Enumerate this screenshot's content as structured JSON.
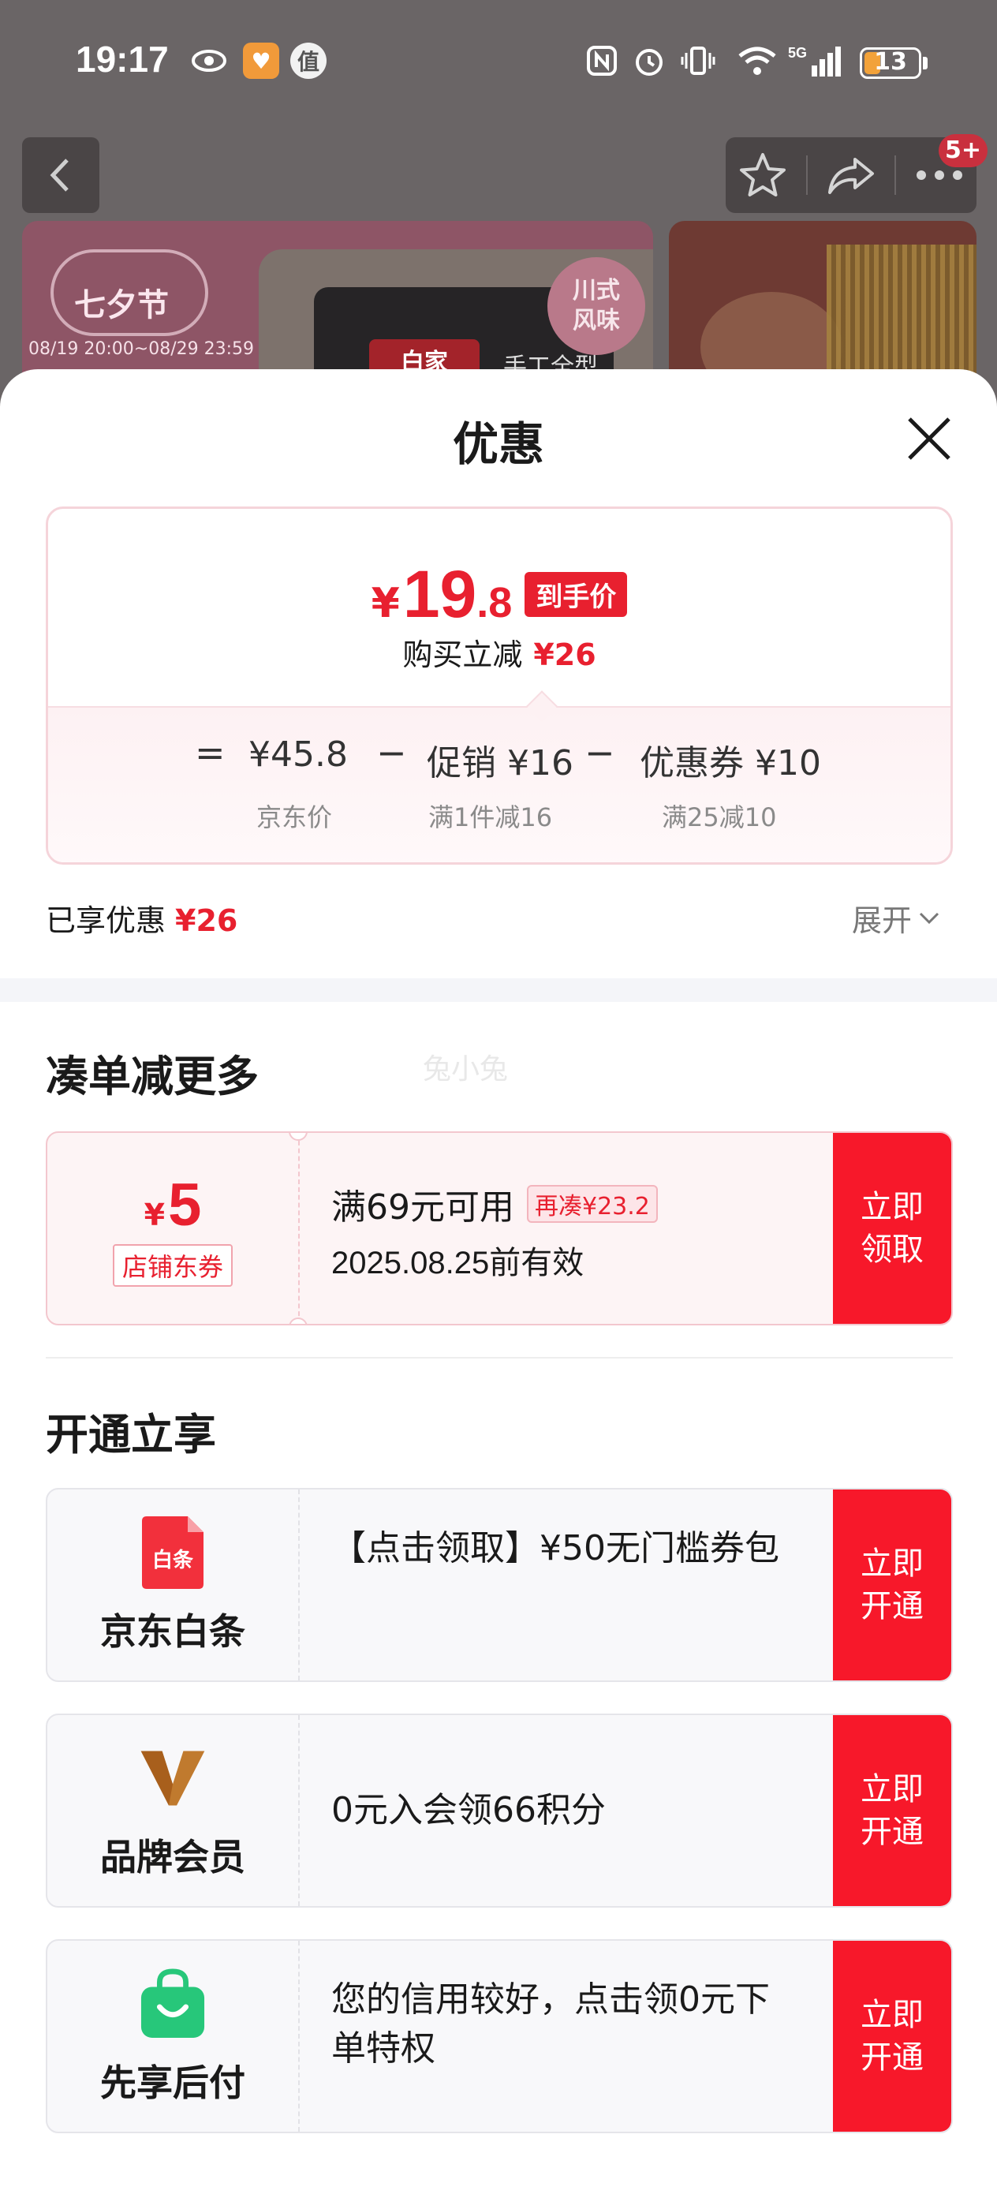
{
  "status_bar": {
    "time": "19:17",
    "value_badge": "值",
    "battery": "13"
  },
  "nav": {
    "message_badge": "5+"
  },
  "banner": {
    "festival": "七夕节",
    "festival_dates": "08/19 20:00~08/29 23:59",
    "flavor": "川式风味",
    "brand_label": "白家",
    "product_text": "手工全型"
  },
  "sheet": {
    "title": "优惠",
    "price_card": {
      "yen": "¥",
      "price_int": "19",
      "price_dec": ".8",
      "price_tag": "到手价",
      "discount_label": "购买立减",
      "discount_value": "¥26",
      "formula": {
        "equals": "=",
        "jd_price": "¥45.8",
        "jd_price_label": "京东价",
        "minus1": "−",
        "promo": "促销 ¥16",
        "promo_label": "满1件减16",
        "minus2": "−",
        "coupon": "优惠券 ¥10",
        "coupon_label": "满25减10"
      }
    },
    "enjoyed_label": "已享优惠",
    "enjoyed_value": "¥26",
    "expand_label": "展开",
    "watermark": "兔小兔",
    "section_more": "凑单减更多",
    "coupon": {
      "yen": "¥",
      "amount": "5",
      "type": "店铺东券",
      "condition": "满69元可用",
      "more": "再凑¥23.2",
      "expiry": "2025.08.25前有效",
      "cta": "立即领取"
    },
    "section_open": "开通立享",
    "services": [
      {
        "name": "京东白条",
        "logo_text": "白条",
        "desc": "【点击领取】¥50无门槛券包",
        "cta": "立即开通"
      },
      {
        "name": "品牌会员",
        "desc": "0元入会领66积分",
        "cta": "立即开通"
      },
      {
        "name": "先享后付",
        "desc": "您的信用较好，点击领0元下单特权",
        "cta": "立即开通"
      }
    ]
  },
  "colors": {
    "accent_red": "#e8202f",
    "cta_red": "#f7182a",
    "baitiao_red": "#f2303c",
    "brand_gold": "#c07a2e",
    "pay_green": "#27c77a"
  },
  "icons": [
    "eye-icon",
    "heart-app-icon",
    "nfc-icon",
    "alarm-icon",
    "vibrate-icon",
    "wifi-icon",
    "signal-icon",
    "back-icon",
    "star-icon",
    "share-icon",
    "more-icon",
    "close-icon",
    "chevron-down-icon"
  ]
}
